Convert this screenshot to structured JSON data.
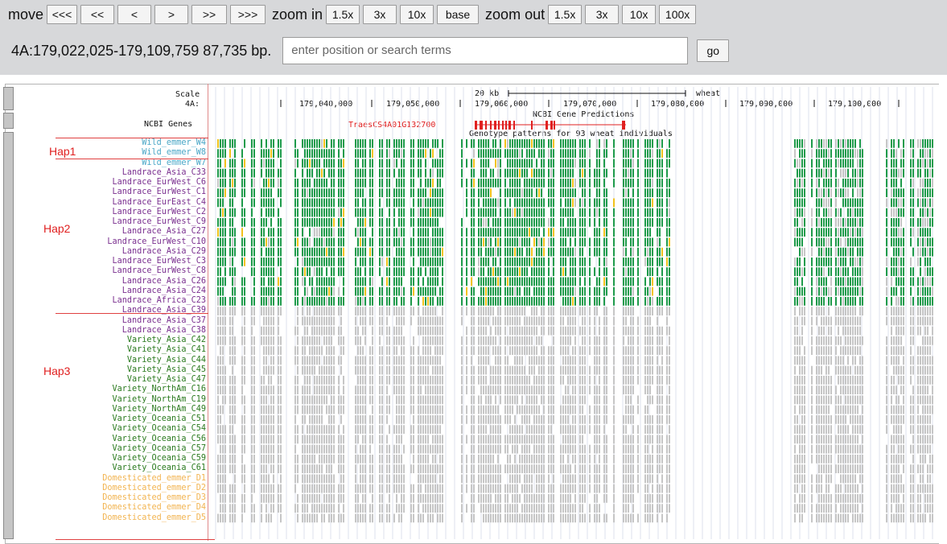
{
  "toolbar": {
    "move_label": "move",
    "move_buttons": [
      "<<<",
      "<<",
      "<",
      ">",
      ">>",
      ">>>"
    ],
    "zoom_in_label": "zoom in",
    "zoom_in_buttons": [
      "1.5x",
      "3x",
      "10x",
      "base"
    ],
    "zoom_out_label": "zoom out",
    "zoom_out_buttons": [
      "1.5x",
      "3x",
      "10x",
      "100x"
    ]
  },
  "position": {
    "text": "4A:179,022,025-179,109,759  87,735 bp.",
    "search_placeholder": "enter position or search terms",
    "go_label": "go"
  },
  "ruler": {
    "scale_label": "Scale",
    "chrom_label": "4A:",
    "scale_bar_text": "20 kb",
    "assembly": "wheat",
    "ticks": [
      "179,040,000",
      "179,050,000",
      "179,060,000",
      "179,070,000",
      "179,080,000",
      "179,090,000",
      "179,100,000"
    ]
  },
  "genes": {
    "track_label": "NCBI Genes",
    "track_title": "NCBI Gene Predictions",
    "gene_name": "TraesCS4A01G132700"
  },
  "genotype_title": "Genotype patterns for 93 wheat individuals",
  "colors": {
    "green": "#1e9b4b",
    "gray": "#c6c6c6",
    "yellow": "#f2c21a",
    "gene_red": "#e02020",
    "label_blue": "#4aa7c7",
    "label_purple": "#7a2f8f",
    "label_green": "#2a7a1e",
    "label_orange": "#f2b451"
  },
  "haplotypes": [
    "Hap1",
    "Hap2",
    "Hap3"
  ],
  "individuals": [
    {
      "name": "Wild_emmer_W4",
      "group": "wild",
      "hap": 1
    },
    {
      "name": "Wild_emmer_W8",
      "group": "wild",
      "hap": 1
    },
    {
      "name": "Wild_emmer_W7",
      "group": "wild",
      "hap": 2
    },
    {
      "name": "Landrace_Asia_C33",
      "group": "landrace",
      "hap": 2
    },
    {
      "name": "Landrace_EurWest_C6",
      "group": "landrace",
      "hap": 2
    },
    {
      "name": "Landrace_EurWest_C1",
      "group": "landrace",
      "hap": 2
    },
    {
      "name": "Landrace_EurEast_C4",
      "group": "landrace",
      "hap": 2
    },
    {
      "name": "Landrace_EurWest_C2",
      "group": "landrace",
      "hap": 2
    },
    {
      "name": "Landrace_EurWest_C9",
      "group": "landrace",
      "hap": 2
    },
    {
      "name": "Landrace_Asia_C27",
      "group": "landrace",
      "hap": 2
    },
    {
      "name": "Landrace_EurWest_C10",
      "group": "landrace",
      "hap": 2
    },
    {
      "name": "Landrace_Asia_C29",
      "group": "landrace",
      "hap": 2
    },
    {
      "name": "Landrace_EurWest_C3",
      "group": "landrace",
      "hap": 2
    },
    {
      "name": "Landrace_EurWest_C8",
      "group": "landrace",
      "hap": 2
    },
    {
      "name": "Landrace_Asia_C26",
      "group": "landrace",
      "hap": 2
    },
    {
      "name": "Landrace_Asia_C24",
      "group": "landrace",
      "hap": 2
    },
    {
      "name": "Landrace_Africa_C23",
      "group": "landrace",
      "hap": 2
    },
    {
      "name": "Landrace_Asia_C39",
      "group": "landrace",
      "hap": 3
    },
    {
      "name": "Landrace_Asia_C37",
      "group": "landrace",
      "hap": 3
    },
    {
      "name": "Landrace_Asia_C38",
      "group": "landrace",
      "hap": 3
    },
    {
      "name": "Variety_Asia_C42",
      "group": "variety",
      "hap": 3
    },
    {
      "name": "Variety_Asia_C41",
      "group": "variety",
      "hap": 3
    },
    {
      "name": "Variety_Asia_C44",
      "group": "variety",
      "hap": 3
    },
    {
      "name": "Variety_Asia_C45",
      "group": "variety",
      "hap": 3
    },
    {
      "name": "Variety_Asia_C47",
      "group": "variety",
      "hap": 3
    },
    {
      "name": "Variety_NorthAm_C16",
      "group": "variety",
      "hap": 3
    },
    {
      "name": "Variety_NorthAm_C19",
      "group": "variety",
      "hap": 3
    },
    {
      "name": "Variety_NorthAm_C49",
      "group": "variety",
      "hap": 3
    },
    {
      "name": "Variety_Oceania_C51",
      "group": "variety",
      "hap": 3
    },
    {
      "name": "Variety_Oceania_C54",
      "group": "variety",
      "hap": 3
    },
    {
      "name": "Variety_Oceania_C56",
      "group": "variety",
      "hap": 3
    },
    {
      "name": "Variety_Oceania_C57",
      "group": "variety",
      "hap": 3
    },
    {
      "name": "Variety_Oceania_C59",
      "group": "variety",
      "hap": 3
    },
    {
      "name": "Variety_Oceania_C61",
      "group": "variety",
      "hap": 3
    },
    {
      "name": "Domesticated_emmer_D1",
      "group": "domesticated",
      "hap": 3
    },
    {
      "name": "Domesticated_emmer_D2",
      "group": "domesticated",
      "hap": 3
    },
    {
      "name": "Domesticated_emmer_D3",
      "group": "domesticated",
      "hap": 3
    },
    {
      "name": "Domesticated_emmer_D4",
      "group": "domesticated",
      "hap": 3
    },
    {
      "name": "Domesticated_emmer_D5",
      "group": "domesticated",
      "hap": 3
    }
  ]
}
